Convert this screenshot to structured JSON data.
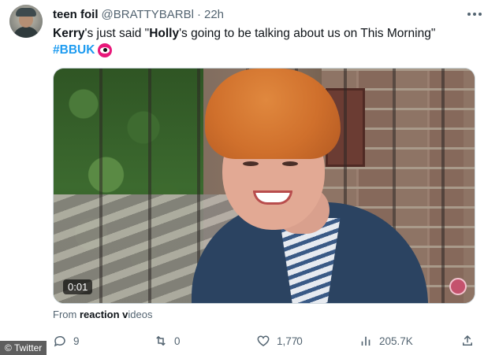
{
  "tweet": {
    "display_name": "teen foil",
    "handle": "@BRATTYBARBl",
    "separator": "·",
    "time": "22h",
    "text_part1": "Kerry",
    "text_part2": "'s just said \"",
    "text_part3": "Holly",
    "text_part4": "'s going to be talking about us on This Morning\"",
    "hashtag": "#BBUK"
  },
  "media": {
    "duration": "0:01"
  },
  "from_line": {
    "prefix": "From ",
    "source": "reaction v",
    "suffix": "ideos"
  },
  "actions": {
    "reply_count": "9",
    "retweet_count": "0",
    "like_count": "1,7",
    "like_count_suffix": "70",
    "views_count": "205.7K"
  },
  "overlay": {
    "watermark": "© Twitter"
  },
  "colors": {
    "link": "#1d9bf0",
    "muted": "#536471",
    "text": "#0f1419"
  }
}
